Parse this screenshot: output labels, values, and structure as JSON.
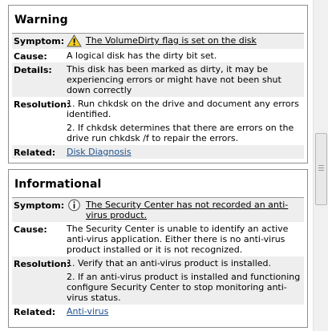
{
  "warning": {
    "title": "Warning",
    "symptom_label": "Symptom:",
    "symptom_text": "The VolumeDirty flag is set on the disk",
    "cause_label": "Cause:",
    "cause_text": "A logical disk has the dirty bit set.",
    "details_label": "Details:",
    "details_text": "This disk has been marked as dirty, it may be experiencing errors or might have not been shut down correctly",
    "resolution_label": "Resolution:",
    "resolution_steps": [
      "1. Run chkdsk on the drive and document any errors identified.",
      "2. If chkdsk determines that there are errors on the drive run chkdsk /f to repair the errors."
    ],
    "related_label": "Related:",
    "related_link": "Disk Diagnosis",
    "icon": "warning-triangle-icon"
  },
  "informational": {
    "title": "Informational",
    "symptom_label": "Symptom:",
    "symptom_text": "The Security Center has not recorded an anti-virus product.",
    "cause_label": "Cause:",
    "cause_text": "The Security Center is unable to identify an active anti-virus application. Either there is no anti-virus product installed or it is not recognized.",
    "resolution_label": "Resolution:",
    "resolution_steps": [
      "1. Verify that an anti-virus product is installed.",
      "2. If an anti-virus product is installed and functioning configure Security Center to stop monitoring anti-virus status."
    ],
    "related_label": "Related:",
    "related_link": "Anti-virus",
    "icon": "information-icon"
  },
  "colors": {
    "link": "#1f4f8c",
    "row_shade": "#eeeeee",
    "border": "#8e8e8e",
    "warning_fill": "#f5d020"
  }
}
